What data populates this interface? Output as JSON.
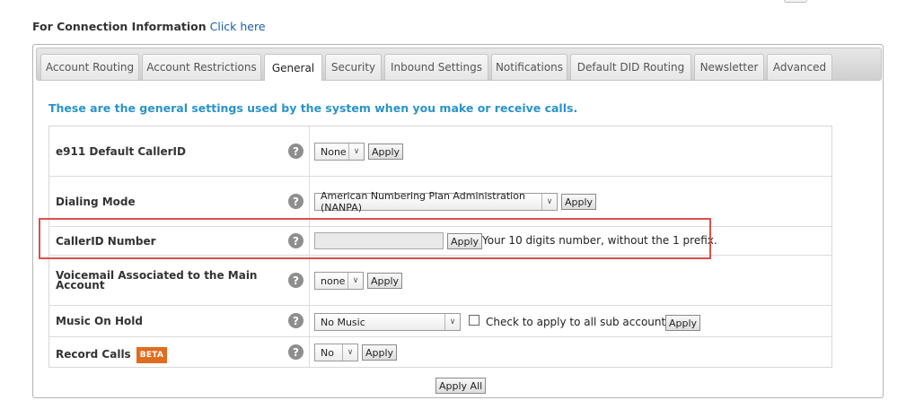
{
  "connection_info": {
    "label": "For Connection Information",
    "link": "Click here"
  },
  "tabs": [
    {
      "label": "Account Routing"
    },
    {
      "label": "Account Restrictions"
    },
    {
      "label": "General",
      "active": true
    },
    {
      "label": "Security"
    },
    {
      "label": "Inbound Settings"
    },
    {
      "label": "Notifications"
    },
    {
      "label": "Default DID Routing"
    },
    {
      "label": "Newsletter"
    },
    {
      "label": "Advanced"
    }
  ],
  "intro_text": "These are the general settings used by the system when you make or receive calls.",
  "rows": {
    "e911": {
      "label": "e911 Default CallerID",
      "select": "None",
      "apply": "Apply"
    },
    "dialing_mode": {
      "label": "Dialing Mode",
      "select": "American Numbering Plan Administration (NANPA)",
      "apply": "Apply"
    },
    "callerid": {
      "label": "CallerID Number",
      "value": "",
      "apply": "Apply",
      "hint": "Your 10 digits number, without the 1 prefix."
    },
    "voicemail": {
      "label": "Voicemail Associated to the Main Account",
      "select": "none",
      "apply": "Apply"
    },
    "moh": {
      "label": "Music On Hold",
      "select": "No Music",
      "checkbox_label": "Check to apply to all sub accounts",
      "checked": false,
      "apply": "Apply"
    },
    "record_calls": {
      "label": "Record Calls",
      "badge": "BETA",
      "select": "No",
      "apply": "Apply"
    }
  },
  "help_symbol": "?",
  "apply_all": "Apply All",
  "colors": {
    "intro": "#2a93c9",
    "link": "#1a5fa8",
    "beta_badge": "#e06d1f",
    "highlight": "#d9504f"
  }
}
